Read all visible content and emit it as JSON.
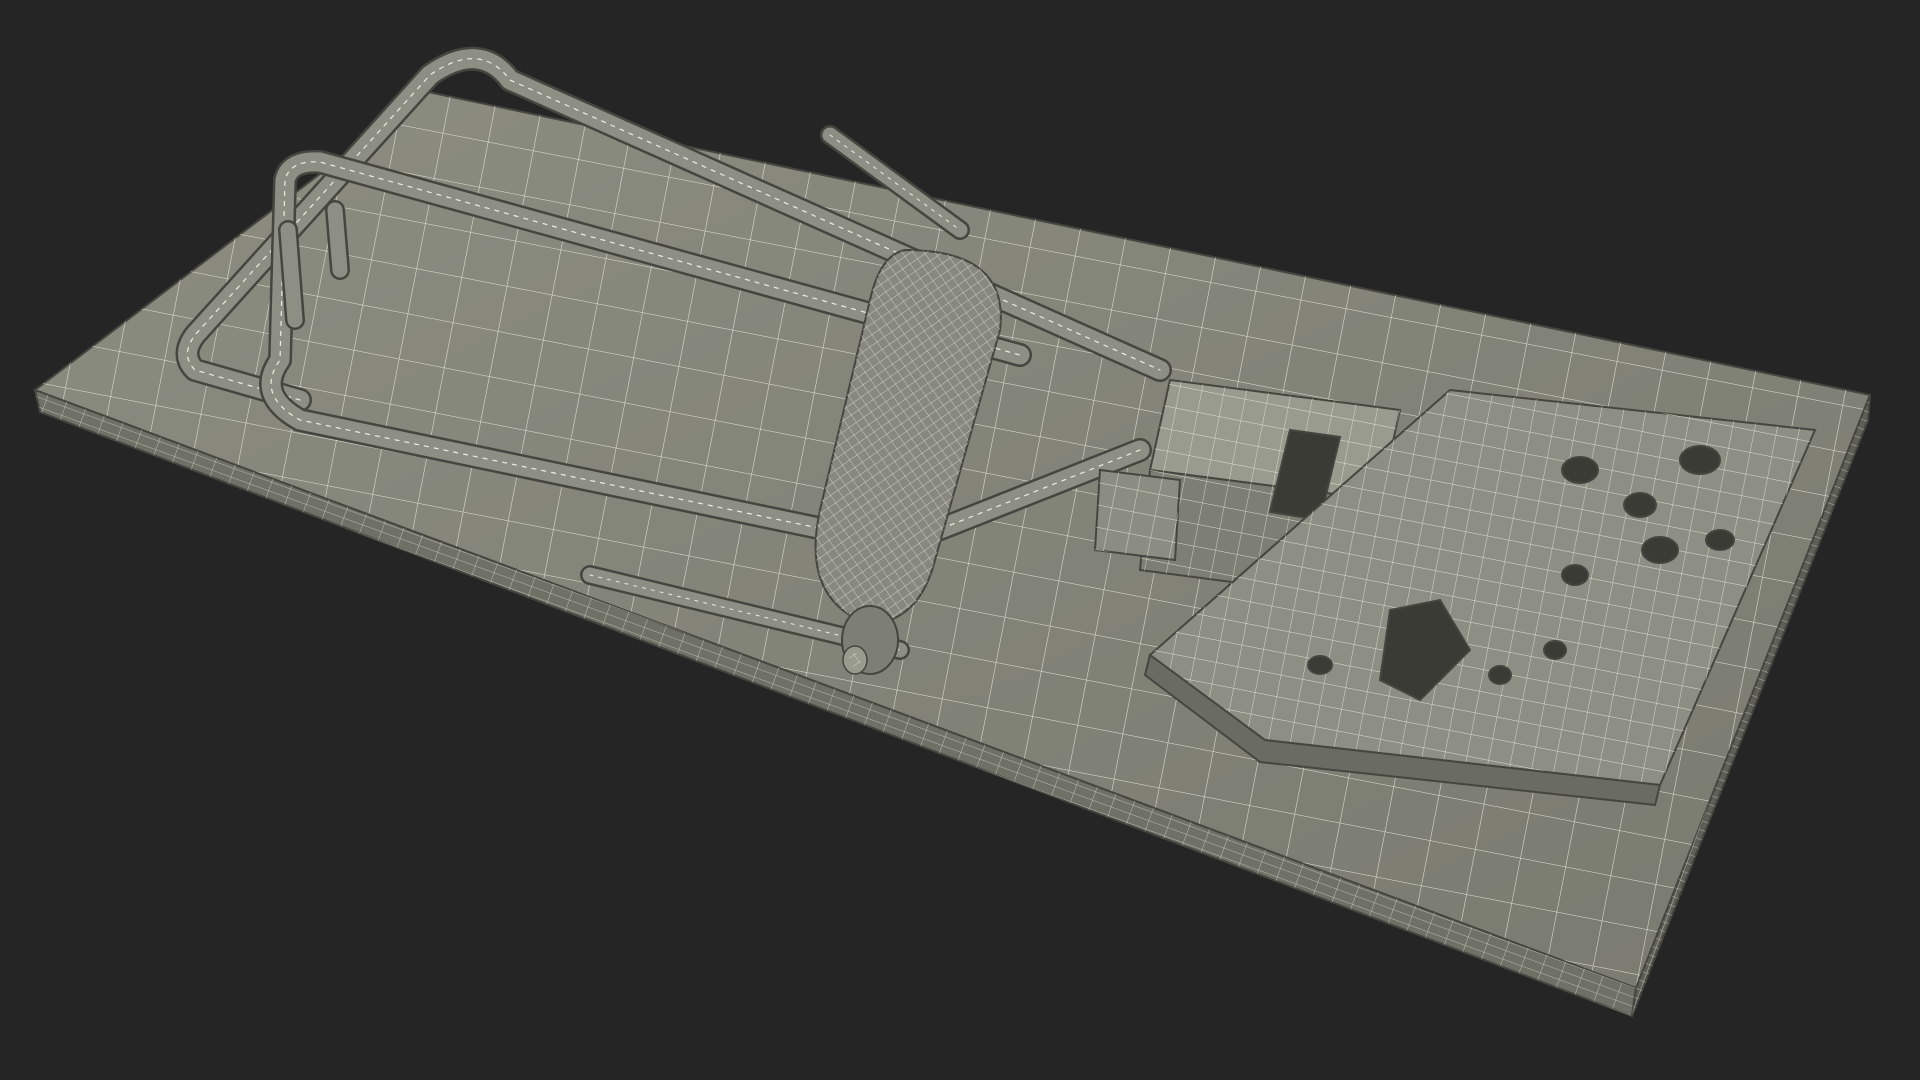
{
  "scene": {
    "subject": "mousetrap-wireframe-render",
    "colors": {
      "background": "#252525",
      "surface": "#84857a",
      "surface_light": "#9a9b8f",
      "surface_dark": "#5e5f56",
      "edge": "#45463f",
      "wire": "#eeeee0"
    }
  }
}
